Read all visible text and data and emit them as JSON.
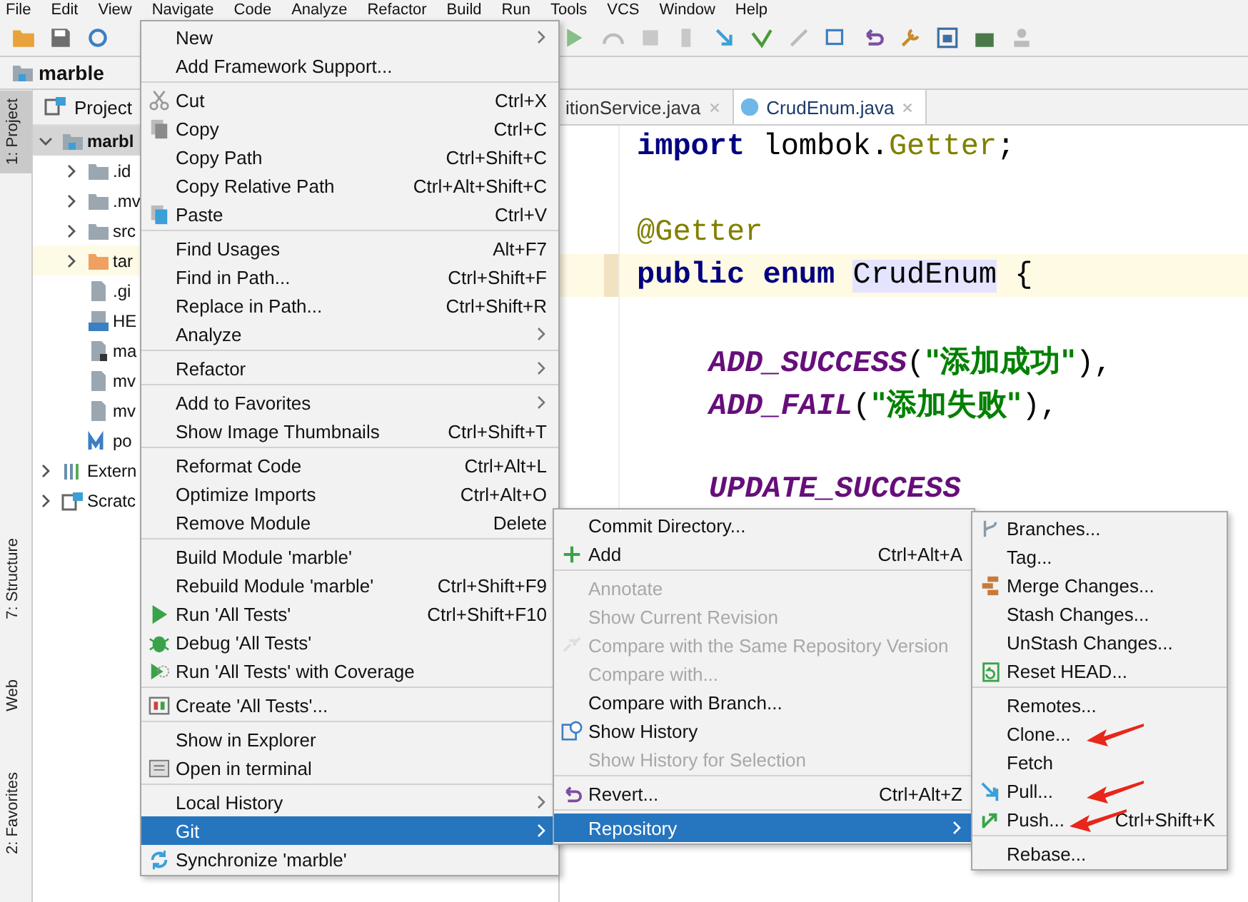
{
  "menu_bar": [
    "File",
    "Edit",
    "View",
    "Navigate",
    "Code",
    "Analyze",
    "Refactor",
    "Build",
    "Run",
    "Tools",
    "VCS",
    "Window",
    "Help"
  ],
  "breadcrumb": "marble",
  "tool_stripe": [
    {
      "label": "1: Project",
      "selected": true
    },
    {
      "label": "7: Structure",
      "selected": false
    },
    {
      "label": "Web",
      "selected": false
    },
    {
      "label": "2: Favorites",
      "selected": false
    }
  ],
  "project_panel": {
    "title": "Project",
    "tree": [
      {
        "label": "marbl",
        "kind": "module",
        "expanded": true,
        "selected": true,
        "children": [
          {
            "label": ".id",
            "kind": "folder",
            "expanded": false,
            "selected": false
          },
          {
            "label": ".mv",
            "kind": "folder",
            "expanded": false,
            "selected": false
          },
          {
            "label": "src",
            "kind": "folder",
            "expanded": false,
            "selected": false
          },
          {
            "label": "tar",
            "kind": "excluded",
            "expanded": false,
            "selected": false
          },
          {
            "label": ".gi",
            "kind": "file",
            "selected": false
          },
          {
            "label": "HE",
            "kind": "markdown",
            "selected": false
          },
          {
            "label": "ma",
            "kind": "script",
            "selected": false
          },
          {
            "label": "mv",
            "kind": "file",
            "selected": false
          },
          {
            "label": "mv",
            "kind": "file",
            "selected": false
          },
          {
            "label": "po",
            "kind": "maven",
            "selected": false
          }
        ]
      },
      {
        "label": "Extern",
        "kind": "libraries",
        "expanded": false,
        "selected": false
      },
      {
        "label": "Scratc",
        "kind": "scratches",
        "expanded": false,
        "selected": false
      }
    ]
  },
  "editor": {
    "tabs": [
      {
        "label": "itionService.java",
        "selected": false
      },
      {
        "label": "CrudEnum.java",
        "selected": true
      }
    ],
    "lines": [
      {
        "kind": "top",
        "current": false,
        "tokens": [
          {
            "kind": "keyword",
            "text": "import"
          },
          {
            "kind": "plain",
            "text": " lombok."
          },
          {
            "kind": "annotation",
            "text": "Getter"
          },
          {
            "kind": "plain",
            "text": ";"
          }
        ]
      },
      {
        "kind": "top",
        "current": false
      },
      {
        "kind": "top",
        "current": false,
        "tokens": [
          {
            "kind": "annotation",
            "text": "@Getter"
          }
        ]
      },
      {
        "kind": "top",
        "current": true,
        "tokens": [
          {
            "kind": "keyword",
            "text": "public enum"
          },
          {
            "kind": "space"
          },
          {
            "kind": "highlight",
            "text": "CrudEnum"
          },
          {
            "kind": "space"
          },
          {
            "kind": "plain",
            "text": "{"
          }
        ]
      },
      {
        "kind": "top",
        "current": false
      },
      {
        "kind": "member",
        "current": false,
        "tokens": [
          {
            "kind": "constant",
            "text": "ADD_SUCCESS"
          },
          {
            "kind": "plain",
            "text": "("
          },
          {
            "kind": "string",
            "text": "\"添加成功\""
          },
          {
            "kind": "plain",
            "text": "),"
          }
        ]
      },
      {
        "kind": "member",
        "current": false,
        "tokens": [
          {
            "kind": "constant",
            "text": "ADD_FAIL"
          },
          {
            "kind": "plain",
            "text": "("
          },
          {
            "kind": "string",
            "text": "\"添加失败\""
          },
          {
            "kind": "plain",
            "text": "),"
          }
        ]
      },
      {
        "kind": "top",
        "current": false
      },
      {
        "kind": "member",
        "current": false,
        "tokens": [
          {
            "kind": "constant",
            "text": "UPDATE_SUCCESS"
          }
        ]
      }
    ]
  },
  "context_menu": {
    "items": [
      {
        "kind": "item",
        "label": "New",
        "submenu": true,
        "disabled": false,
        "selected": false
      },
      {
        "kind": "item",
        "label": "Add Framework Support...",
        "disabled": false,
        "selected": false
      },
      {
        "kind": "separator"
      },
      {
        "kind": "item",
        "label": "Cut",
        "shortcut": "Ctrl+X",
        "disabled": false,
        "selected": false
      },
      {
        "kind": "item",
        "label": "Copy",
        "shortcut": "Ctrl+C",
        "disabled": false,
        "selected": false
      },
      {
        "kind": "item",
        "label": "Copy Path",
        "shortcut": "Ctrl+Shift+C",
        "disabled": false,
        "selected": false
      },
      {
        "kind": "item",
        "label": "Copy Relative Path",
        "shortcut": "Ctrl+Alt+Shift+C",
        "disabled": false,
        "selected": false
      },
      {
        "kind": "item",
        "label": "Paste",
        "shortcut": "Ctrl+V",
        "disabled": false,
        "selected": false
      },
      {
        "kind": "separator"
      },
      {
        "kind": "item",
        "label": "Find Usages",
        "shortcut": "Alt+F7",
        "disabled": false,
        "selected": false
      },
      {
        "kind": "item",
        "label": "Find in Path...",
        "shortcut": "Ctrl+Shift+F",
        "disabled": false,
        "selected": false
      },
      {
        "kind": "item",
        "label": "Replace in Path...",
        "shortcut": "Ctrl+Shift+R",
        "disabled": false,
        "selected": false
      },
      {
        "kind": "item",
        "label": "Analyze",
        "submenu": true,
        "disabled": false,
        "selected": false
      },
      {
        "kind": "separator"
      },
      {
        "kind": "item",
        "label": "Refactor",
        "submenu": true,
        "disabled": false,
        "selected": false
      },
      {
        "kind": "separator"
      },
      {
        "kind": "item",
        "label": "Add to Favorites",
        "submenu": true,
        "disabled": false,
        "selected": false
      },
      {
        "kind": "item",
        "label": "Show Image Thumbnails",
        "shortcut": "Ctrl+Shift+T",
        "disabled": false,
        "selected": false
      },
      {
        "kind": "separator"
      },
      {
        "kind": "item",
        "label": "Reformat Code",
        "shortcut": "Ctrl+Alt+L",
        "disabled": false,
        "selected": false
      },
      {
        "kind": "item",
        "label": "Optimize Imports",
        "shortcut": "Ctrl+Alt+O",
        "disabled": false,
        "selected": false
      },
      {
        "kind": "item",
        "label": "Remove Module",
        "shortcut": "Delete",
        "disabled": false,
        "selected": false
      },
      {
        "kind": "separator"
      },
      {
        "kind": "item",
        "label": "Build Module 'marble'",
        "disabled": false,
        "selected": false
      },
      {
        "kind": "item",
        "label": "Rebuild Module 'marble'",
        "shortcut": "Ctrl+Shift+F9",
        "disabled": false,
        "selected": false
      },
      {
        "kind": "item",
        "label": "Run 'All Tests'",
        "shortcut": "Ctrl+Shift+F10",
        "disabled": false,
        "selected": false
      },
      {
        "kind": "item",
        "label": "Debug 'All Tests'",
        "disabled": false,
        "selected": false
      },
      {
        "kind": "item",
        "label": "Run 'All Tests' with Coverage",
        "disabled": false,
        "selected": false
      },
      {
        "kind": "separator"
      },
      {
        "kind": "item",
        "label": "Create 'All Tests'...",
        "disabled": false,
        "selected": false
      },
      {
        "kind": "separator"
      },
      {
        "kind": "item",
        "label": "Show in Explorer",
        "disabled": false,
        "selected": false
      },
      {
        "kind": "item",
        "label": "Open in terminal",
        "disabled": false,
        "selected": false
      },
      {
        "kind": "separator"
      },
      {
        "kind": "item",
        "label": "Local History",
        "submenu": true,
        "disabled": false,
        "selected": false
      },
      {
        "kind": "item",
        "label": "Git",
        "submenu": true,
        "disabled": false,
        "selected": true
      },
      {
        "kind": "item",
        "label": "Synchronize 'marble'",
        "disabled": false,
        "selected": false
      }
    ]
  },
  "git_menu": {
    "items": [
      {
        "kind": "item",
        "label": "Commit Directory...",
        "disabled": false,
        "selected": false
      },
      {
        "kind": "item",
        "label": "Add",
        "shortcut": "Ctrl+Alt+A",
        "disabled": false,
        "selected": false
      },
      {
        "kind": "separator"
      },
      {
        "kind": "item",
        "label": "Annotate",
        "disabled": true,
        "selected": false
      },
      {
        "kind": "item",
        "label": "Show Current Revision",
        "disabled": true,
        "selected": false
      },
      {
        "kind": "item",
        "label": "Compare with the Same Repository Version",
        "disabled": true,
        "selected": false
      },
      {
        "kind": "item",
        "label": "Compare with...",
        "disabled": true,
        "selected": false
      },
      {
        "kind": "item",
        "label": "Compare with Branch...",
        "disabled": false,
        "selected": false
      },
      {
        "kind": "item",
        "label": "Show History",
        "disabled": false,
        "selected": false
      },
      {
        "kind": "item",
        "label": "Show History for Selection",
        "disabled": true,
        "selected": false
      },
      {
        "kind": "separator"
      },
      {
        "kind": "item",
        "label": "Revert...",
        "shortcut": "Ctrl+Alt+Z",
        "disabled": false,
        "selected": false
      },
      {
        "kind": "separator"
      },
      {
        "kind": "item",
        "label": "Repository",
        "submenu": true,
        "disabled": false,
        "selected": true
      }
    ]
  },
  "repository_menu": {
    "items": [
      {
        "kind": "item",
        "label": "Branches...",
        "disabled": false,
        "selected": false,
        "marked": false
      },
      {
        "kind": "item",
        "label": "Tag...",
        "disabled": false,
        "selected": false,
        "marked": false
      },
      {
        "kind": "item",
        "label": "Merge Changes...",
        "disabled": false,
        "selected": false,
        "marked": false
      },
      {
        "kind": "item",
        "label": "Stash Changes...",
        "disabled": false,
        "selected": false,
        "marked": false
      },
      {
        "kind": "item",
        "label": "UnStash Changes...",
        "disabled": false,
        "selected": false,
        "marked": false
      },
      {
        "kind": "item",
        "label": "Reset HEAD...",
        "disabled": false,
        "selected": false,
        "marked": false
      },
      {
        "kind": "separator"
      },
      {
        "kind": "item",
        "label": "Remotes...",
        "disabled": false,
        "selected": false,
        "marked": false
      },
      {
        "kind": "item",
        "label": "Clone...",
        "disabled": false,
        "selected": false,
        "marked": true
      },
      {
        "kind": "item",
        "label": "Fetch",
        "disabled": false,
        "selected": false,
        "marked": false
      },
      {
        "kind": "item",
        "label": "Pull...",
        "disabled": false,
        "selected": false,
        "marked": true
      },
      {
        "kind": "item",
        "label": "Push...",
        "shortcut": "Ctrl+Shift+K",
        "disabled": false,
        "selected": false,
        "marked": true
      },
      {
        "kind": "separator"
      },
      {
        "kind": "item",
        "label": "Rebase...",
        "disabled": false,
        "selected": false,
        "marked": false
      }
    ]
  }
}
